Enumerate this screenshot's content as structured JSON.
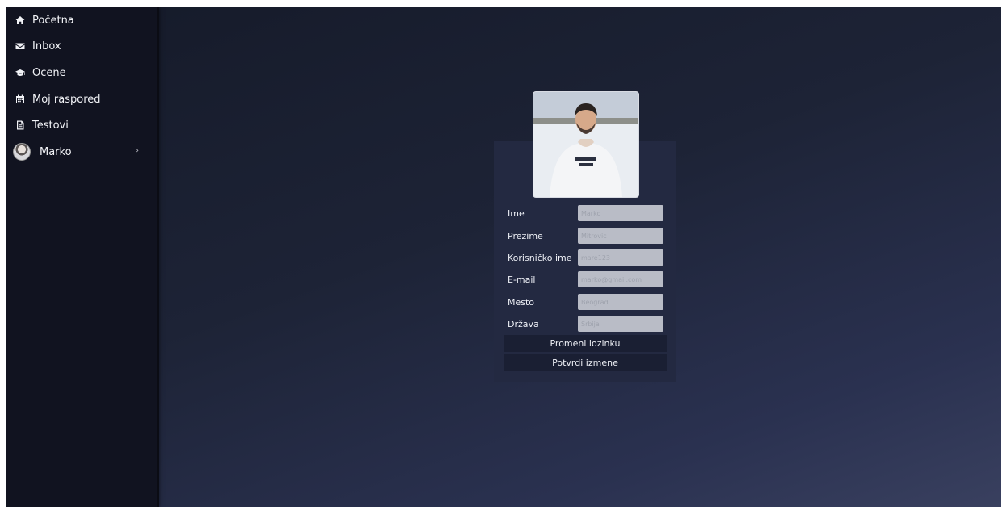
{
  "sidebar": {
    "items": [
      {
        "label": "Početna",
        "icon": "home-icon"
      },
      {
        "label": "Inbox",
        "icon": "envelope-icon"
      },
      {
        "label": "Ocene",
        "icon": "graduation-cap-icon"
      },
      {
        "label": "Moj raspored",
        "icon": "calendar-icon"
      },
      {
        "label": "Testovi",
        "icon": "document-icon"
      }
    ],
    "user": {
      "label": "Marko",
      "chevron": "›"
    }
  },
  "profile": {
    "fields": [
      {
        "label": "Ime",
        "value": "",
        "placeholder": "Marko"
      },
      {
        "label": "Prezime",
        "value": "",
        "placeholder": "Mitrovic"
      },
      {
        "label": "Korisničko ime",
        "value": "",
        "placeholder": "mare123"
      },
      {
        "label": "E-mail",
        "value": "",
        "placeholder": "marko@gmail.com"
      },
      {
        "label": "Mesto",
        "value": "",
        "placeholder": "Beograd"
      },
      {
        "label": "Država",
        "value": "",
        "placeholder": "Srbija"
      }
    ],
    "change_password_label": "Promeni lozinku",
    "confirm_changes_label": "Potvrdi izmene"
  },
  "colors": {
    "sidebar_bg": "#111320",
    "card_bg": "#232941",
    "button_bg": "#1a1f33",
    "input_bg": "#b9bcc6",
    "text": "#eef0f6"
  }
}
